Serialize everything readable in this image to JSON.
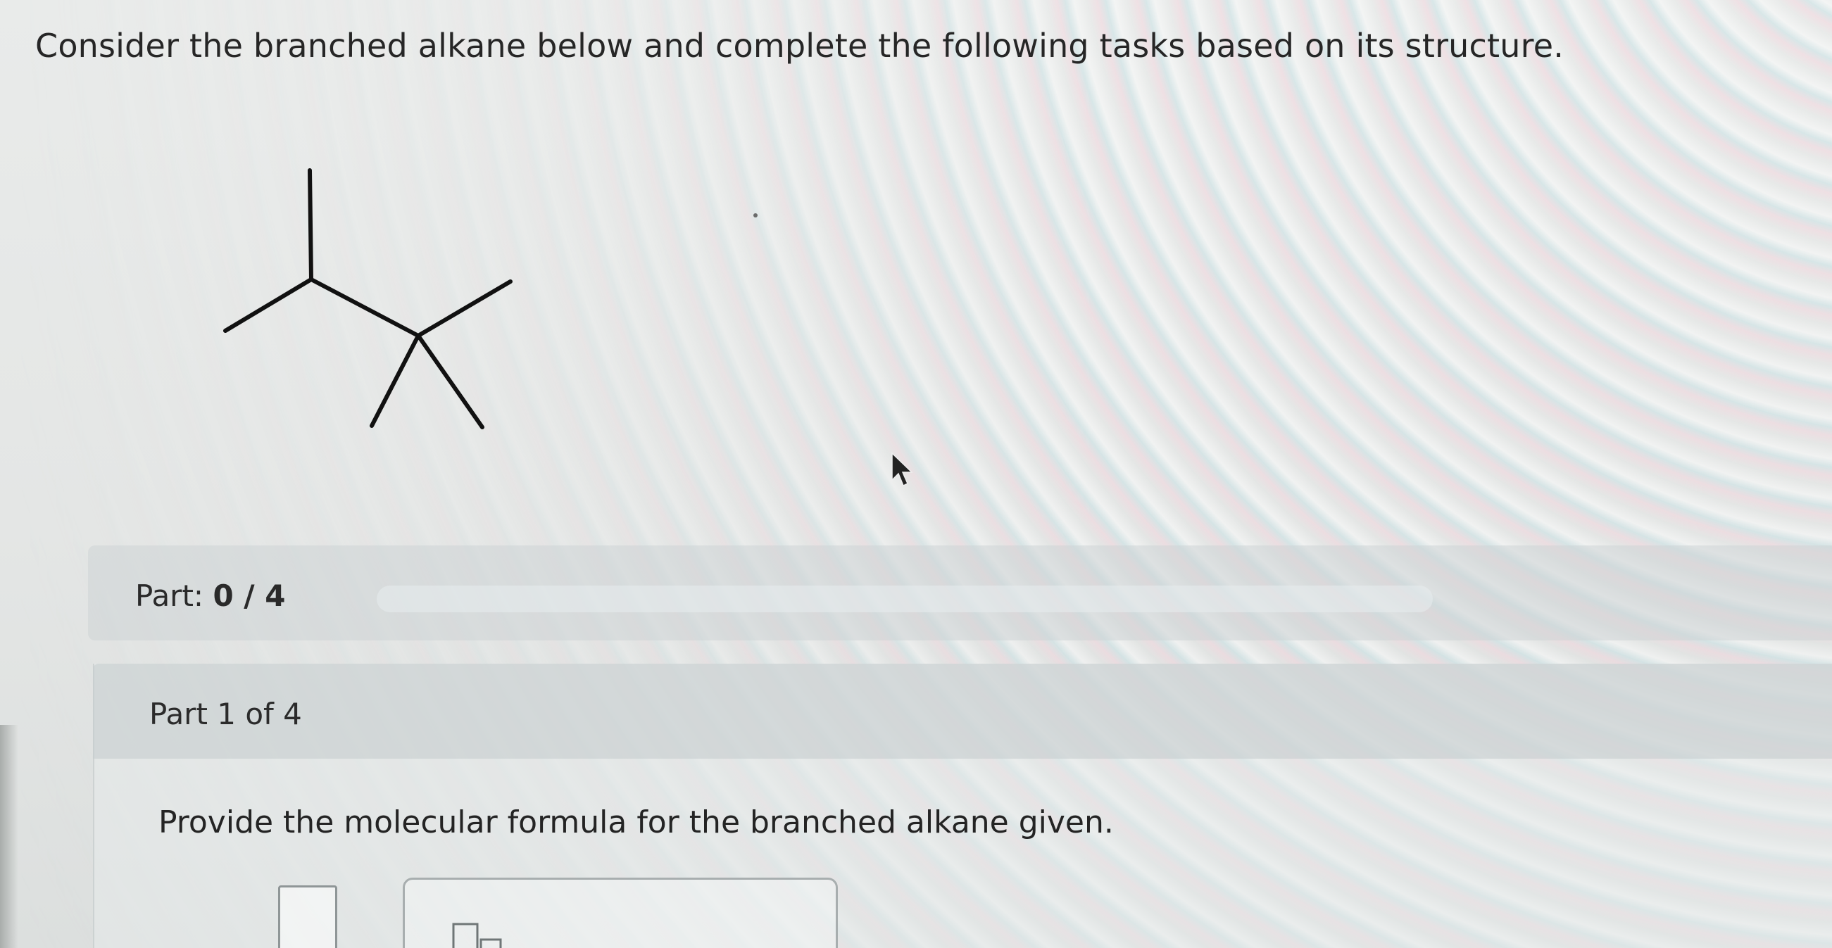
{
  "question": {
    "text": "Consider the branched alkane below and complete the following tasks based on its structure."
  },
  "progress": {
    "label": "Part:",
    "value": "0 / 4",
    "completed": 0,
    "total": 4
  },
  "section": {
    "header": "Part 1 of 4",
    "instruction": "Provide the molecular formula for the branched alkane given."
  },
  "answer": {
    "value": ""
  },
  "icons": {
    "cursor": "mouse-pointer-icon",
    "subscript": "subscript-template-icon"
  },
  "colors": {
    "text": "#262626",
    "bond": "#111111",
    "bar": "#cdd4d6"
  }
}
